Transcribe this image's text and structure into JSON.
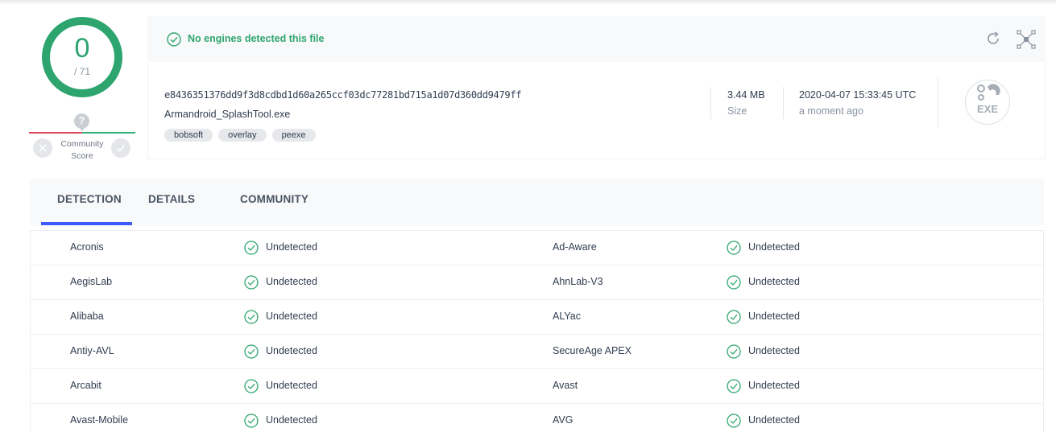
{
  "score": {
    "detected": "0",
    "total": "/ 71",
    "community_label_1": "Community",
    "community_label_2": "Score",
    "question_mark": "?"
  },
  "header": {
    "status": "No engines detected this file",
    "hash": "e8436351376dd9f3d8cdbd1d60a265ccf03dc77281bd715a1d07d360dd9479ff",
    "filename": "Armandroid_SplashTool.exe",
    "tags": [
      "bobsoft",
      "overlay",
      "peexe"
    ],
    "size_value": "3.44 MB",
    "size_label": "Size",
    "date_value": "2020-04-07 15:33:45 UTC",
    "date_label": "a moment ago",
    "file_type": "EXE"
  },
  "tabs": [
    "DETECTION",
    "DETAILS",
    "COMMUNITY"
  ],
  "rows": [
    {
      "left_engine": "Acronis",
      "left_result": "Undetected",
      "right_engine": "Ad-Aware",
      "right_result": "Undetected"
    },
    {
      "left_engine": "AegisLab",
      "left_result": "Undetected",
      "right_engine": "AhnLab-V3",
      "right_result": "Undetected"
    },
    {
      "left_engine": "Alibaba",
      "left_result": "Undetected",
      "right_engine": "ALYac",
      "right_result": "Undetected"
    },
    {
      "left_engine": "Antiy-AVL",
      "left_result": "Undetected",
      "right_engine": "SecureAge APEX",
      "right_result": "Undetected"
    },
    {
      "left_engine": "Arcabit",
      "left_result": "Undetected",
      "right_engine": "Avast",
      "right_result": "Undetected"
    },
    {
      "left_engine": "Avast-Mobile",
      "left_result": "Undetected",
      "right_engine": "AVG",
      "right_result": "Undetected"
    }
  ],
  "colors": {
    "clean_green": "#2ea56f",
    "tab_accent": "#3d5afe",
    "bad_red": "#e04059"
  }
}
